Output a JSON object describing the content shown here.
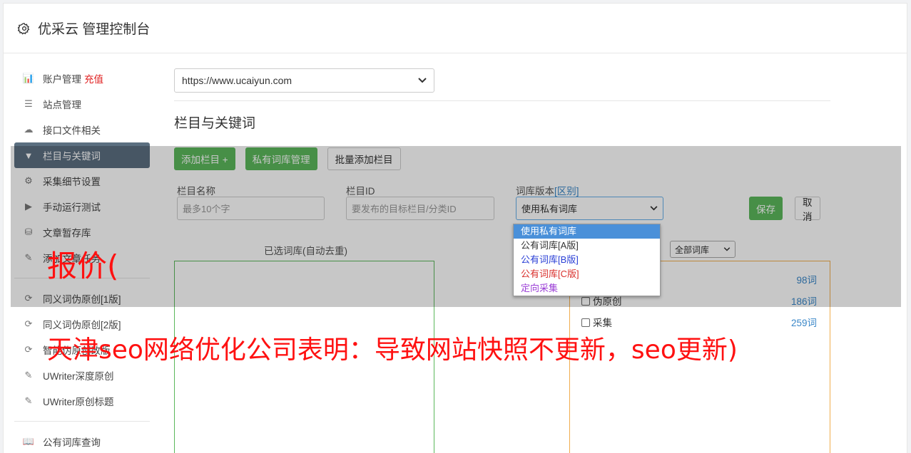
{
  "header": {
    "title": "优采云 管理控制台",
    "icon": "gear-icon"
  },
  "sidebar": {
    "groups": [
      [
        {
          "label": "账户管理",
          "extra": "充值",
          "icon": "bar-chart-icon",
          "glyph": "📊"
        },
        {
          "label": "站点管理",
          "icon": "server-icon",
          "glyph": "☰"
        },
        {
          "label": "接口文件相关",
          "icon": "cloud-upload-icon",
          "glyph": "☁"
        },
        {
          "label": "栏目与关键词",
          "icon": "filter-icon",
          "glyph": "▼",
          "active": true
        },
        {
          "label": "采集细节设置",
          "icon": "cogs-icon",
          "glyph": "⚙"
        },
        {
          "label": "手动运行测试",
          "icon": "play-circle-icon",
          "glyph": "▶"
        },
        {
          "label": "文章暂存库",
          "icon": "database-icon",
          "glyph": "⛁"
        },
        {
          "label": "添加文章任务",
          "icon": "edit-icon",
          "glyph": "✎"
        }
      ],
      [
        {
          "label": "同义词伪原创[1版]",
          "icon": "refresh-icon",
          "glyph": "⟳"
        },
        {
          "label": "同义词伪原创[2版]",
          "icon": "refresh-icon",
          "glyph": "⟳"
        },
        {
          "label": "智能伪原创改版",
          "icon": "refresh-icon",
          "glyph": "⟳"
        },
        {
          "label": "UWriter深度原创",
          "icon": "edit-icon",
          "glyph": "✎"
        },
        {
          "label": "UWriter原创标题",
          "icon": "edit-icon",
          "glyph": "✎"
        }
      ],
      [
        {
          "label": "公有词库查询",
          "icon": "book-icon",
          "glyph": "📖"
        }
      ]
    ]
  },
  "main": {
    "site_select": "https://www.ucaiyun.com",
    "section_title": "栏目与关键词",
    "buttons": {
      "add_column": "添加栏目 +",
      "private_lib": "私有词库管理",
      "batch_add": "批量添加栏目"
    },
    "form": {
      "name_label": "栏目名称",
      "name_placeholder": "最多10个字",
      "id_label": "栏目ID",
      "id_placeholder": "要发布的目标栏目/分类ID",
      "version_label": "词库版本",
      "version_link": "[区别]",
      "version_value": "使用私有词库",
      "save": "保存",
      "cancel": "取消"
    },
    "version_options": [
      {
        "label": "使用私有词库",
        "color": "#ffffff",
        "bg": "#4a90d9"
      },
      {
        "label": "公有词库[A版]",
        "color": "#333333",
        "bg": ""
      },
      {
        "label": "公有词库[B版]",
        "color": "#2a3fd6",
        "bg": ""
      },
      {
        "label": "公有词库[C版]",
        "color": "#d9302c",
        "bg": ""
      },
      {
        "label": "定向采集",
        "color": "#9b3fd6",
        "bg": ""
      }
    ],
    "selected_title": "已选词库(自动去重)",
    "filter_select": "全部词库",
    "libraries": [
      {
        "label": "",
        "count": "98词",
        "checkbox": false
      },
      {
        "label": "伪原创",
        "count": "186词",
        "checkbox": true
      },
      {
        "label": "采集",
        "count": "259词",
        "checkbox": true
      }
    ]
  },
  "watermark": {
    "line1": "报价(",
    "line2": "天津seo网络优化公司表明：导致网站快照不更新，seo更新)"
  }
}
